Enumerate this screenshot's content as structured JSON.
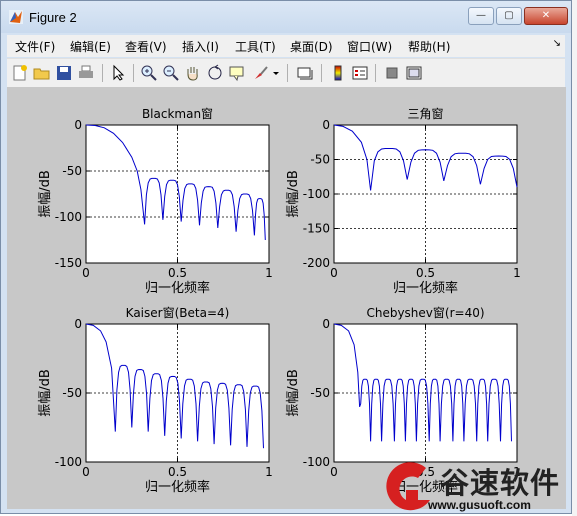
{
  "window": {
    "title": "Figure 2",
    "controls": {
      "minimize": "—",
      "maximize": "▢",
      "close": "✕"
    }
  },
  "menubar": {
    "items": [
      "文件(F)",
      "编辑(E)",
      "查看(V)",
      "插入(I)",
      "工具(T)",
      "桌面(D)",
      "窗口(W)",
      "帮助(H)"
    ]
  },
  "toolbar": {
    "buttons": [
      "new-figure-icon",
      "open-folder-icon",
      "save-disk-icon",
      "print-icon",
      "pointer-arrow-icon",
      "zoom-in-icon",
      "zoom-out-icon",
      "pan-hand-icon",
      "rotate-3d-icon",
      "data-cursor-icon",
      "brush-icon",
      "brush-dropdown-icon",
      "link-plot-icon",
      "colorbar-icon",
      "legend-icon",
      "hide-plot-tools-icon",
      "show-plot-tools-icon"
    ]
  },
  "chart_data": [
    {
      "type": "line",
      "title": "Blackman窗",
      "xlabel": "归一化频率",
      "ylabel": "振幅/dB",
      "xlim": [
        0,
        1
      ],
      "ylim": [
        -150,
        0
      ],
      "xticks": [
        "0",
        "0.5",
        "1"
      ],
      "yticks": [
        "0",
        "-50",
        "-100",
        "-150"
      ],
      "grid": true,
      "color": "#0000cc",
      "mainlobe": [
        [
          0,
          0
        ],
        [
          0.05,
          -0.5
        ],
        [
          0.1,
          -3
        ],
        [
          0.15,
          -9
        ],
        [
          0.2,
          -19
        ],
        [
          0.25,
          -35
        ],
        [
          0.28,
          -50
        ],
        [
          0.3,
          -70
        ],
        [
          0.32,
          -108
        ]
      ],
      "nulls": [
        0.32,
        0.42,
        0.52,
        0.62,
        0.72,
        0.82,
        0.92,
        0.98
      ],
      "sidelobes": [
        -58,
        -60,
        -64,
        -67,
        -71,
        -75,
        -80
      ]
    },
    {
      "type": "line",
      "title": "三角窗",
      "xlabel": "归一化频率",
      "ylabel": "振幅/dB",
      "xlim": [
        0,
        1
      ],
      "ylim": [
        -200,
        0
      ],
      "xticks": [
        "0",
        "0.5",
        "1"
      ],
      "yticks": [
        "0",
        "-50",
        "-100",
        "-150",
        "-200"
      ],
      "grid": true,
      "color": "#0000cc",
      "mainlobe": [
        [
          0,
          0
        ],
        [
          0.05,
          -2
        ],
        [
          0.1,
          -9
        ],
        [
          0.15,
          -25
        ],
        [
          0.18,
          -50
        ],
        [
          0.2,
          -95
        ]
      ],
      "nulls": [
        0.2,
        0.4,
        0.6,
        0.8,
        1.0
      ],
      "sidelobes": [
        -34,
        -36,
        -41,
        -45
      ]
    },
    {
      "type": "line",
      "title": "Kaiser窗(Beta=4)",
      "xlabel": "归一化频率",
      "ylabel": "振幅/dB",
      "xlim": [
        0,
        1
      ],
      "ylim": [
        -100,
        0
      ],
      "xticks": [
        "0",
        "0.5",
        "1"
      ],
      "yticks": [
        "0",
        "-50",
        "-100"
      ],
      "grid": true,
      "color": "#0000cc",
      "mainlobe": [
        [
          0,
          0
        ],
        [
          0.04,
          -1
        ],
        [
          0.08,
          -5
        ],
        [
          0.11,
          -13
        ],
        [
          0.14,
          -32
        ],
        [
          0.16,
          -78
        ]
      ],
      "nulls": [
        0.16,
        0.25,
        0.34,
        0.43,
        0.52,
        0.61,
        0.7,
        0.79,
        0.88,
        0.97
      ],
      "sidelobes": [
        -30,
        -33,
        -36,
        -38,
        -40,
        -42,
        -43,
        -44,
        -45
      ]
    },
    {
      "type": "line",
      "title": "Chebyshev窗(r=40)",
      "xlabel": "归一化频率",
      "ylabel": "振幅/dB",
      "xlim": [
        0,
        1
      ],
      "ylim": [
        -100,
        0
      ],
      "xticks": [
        "0",
        "0.5",
        "1"
      ],
      "yticks": [
        "0",
        "-50",
        "-100"
      ],
      "grid": true,
      "color": "#0000cc",
      "mainlobe": [
        [
          0,
          0
        ],
        [
          0.04,
          -1
        ],
        [
          0.08,
          -5
        ],
        [
          0.11,
          -15
        ],
        [
          0.13,
          -35
        ],
        [
          0.14,
          -60
        ]
      ],
      "nulls": [
        0.14,
        0.2,
        0.26,
        0.33,
        0.39,
        0.45,
        0.52,
        0.58,
        0.65,
        0.71,
        0.78,
        0.84,
        0.91,
        0.97
      ],
      "sidelobes": [
        -40,
        -40,
        -40,
        -40,
        -40,
        -40,
        -40,
        -40,
        -40,
        -40,
        -40,
        -40,
        -40
      ]
    }
  ],
  "watermark": {
    "text": "谷速软件",
    "url": "www.gusuoft.com"
  }
}
